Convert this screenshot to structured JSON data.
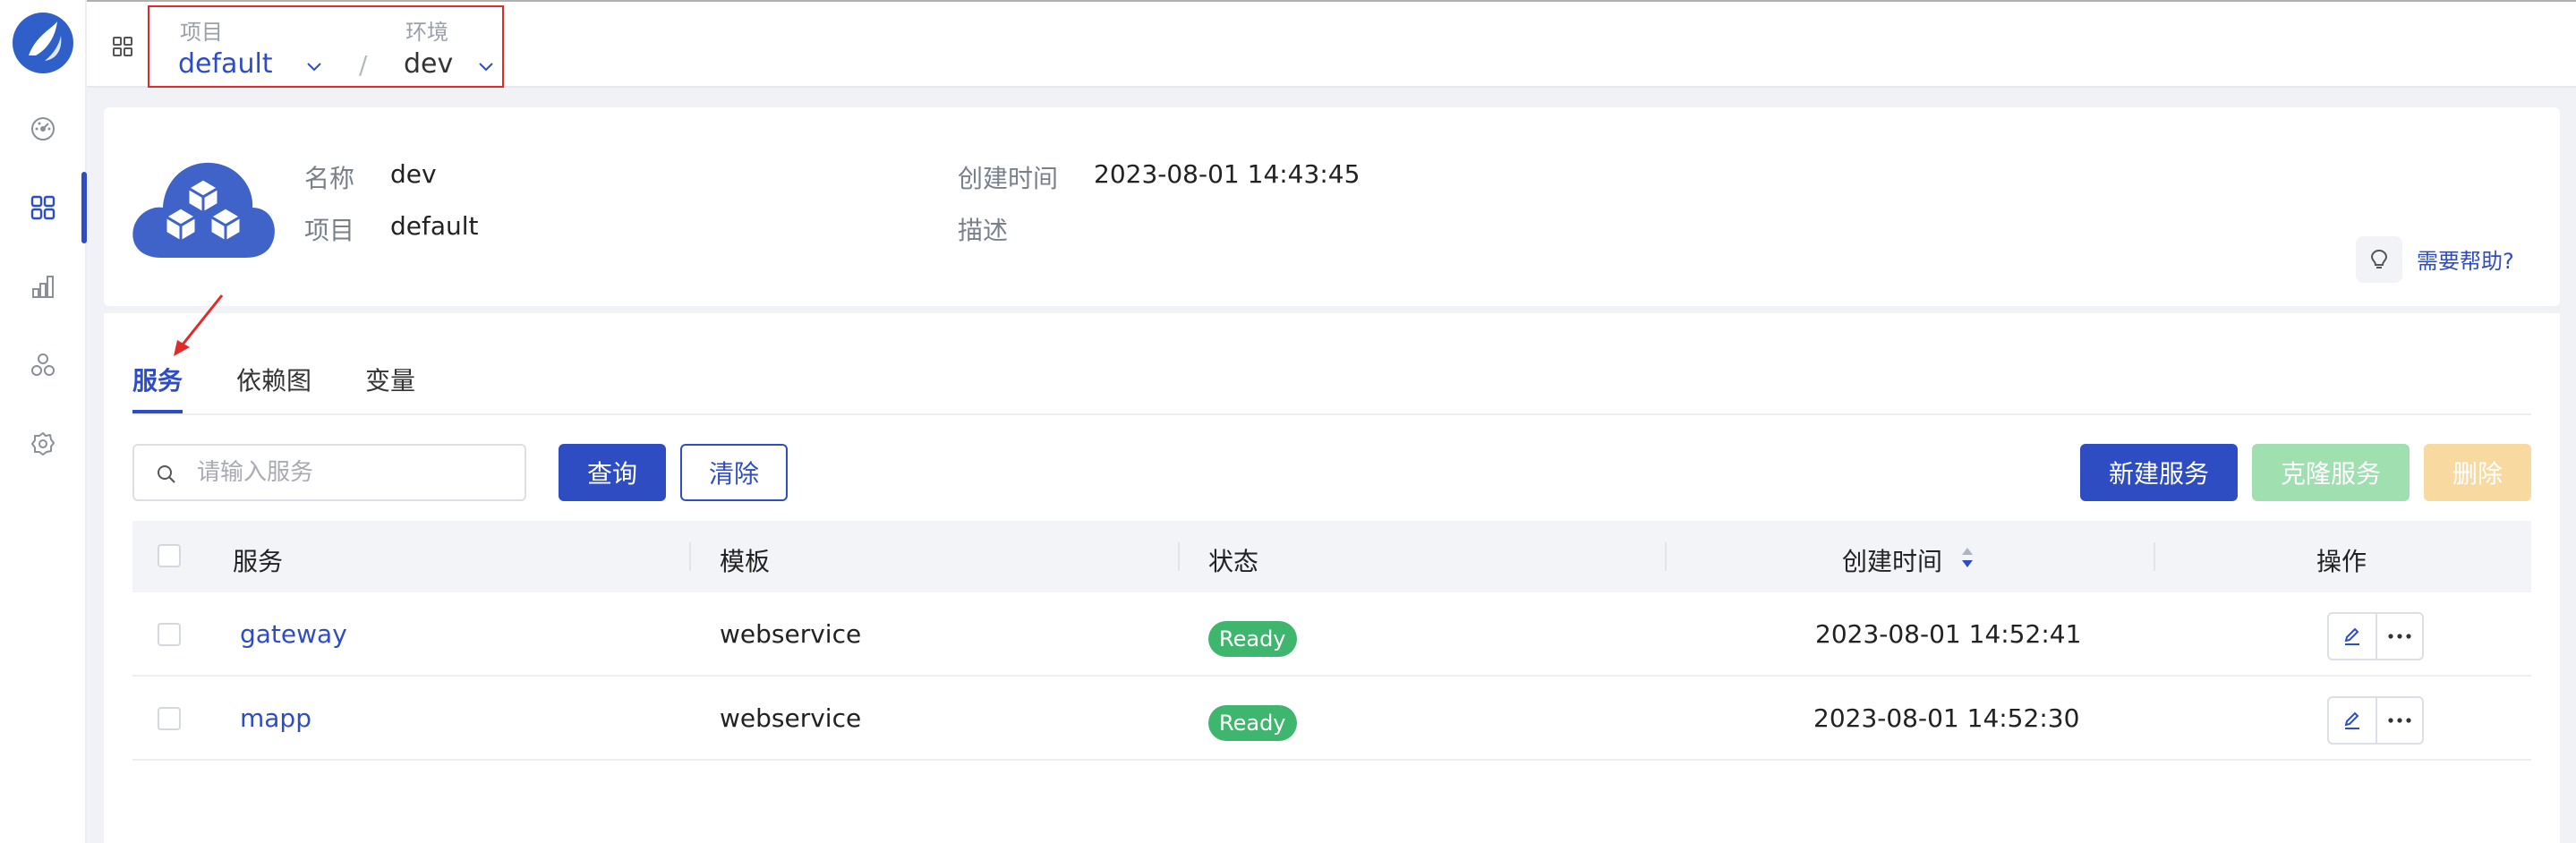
{
  "topbar": {
    "project_label": "项目",
    "project_value": "default",
    "env_label": "环境",
    "env_value": "dev",
    "separator": "/"
  },
  "sidebar": {
    "items": [
      {
        "icon": "dashboard-icon"
      },
      {
        "icon": "apps-grid-icon",
        "active": true
      },
      {
        "icon": "bar-chart-icon"
      },
      {
        "icon": "cluster-icon"
      },
      {
        "icon": "gear-icon"
      }
    ]
  },
  "info": {
    "name_label": "名称",
    "name_value": "dev",
    "project_label": "项目",
    "project_value": "default",
    "created_label": "创建时间",
    "created_value": "2023-08-01 14:43:45",
    "desc_label": "描述",
    "desc_value": "",
    "help_text": "需要帮助?"
  },
  "tabs": [
    {
      "label": "服务",
      "active": true
    },
    {
      "label": "依赖图",
      "active": false
    },
    {
      "label": "变量",
      "active": false
    }
  ],
  "toolbar": {
    "search_placeholder": "请输入服务",
    "search_value": "",
    "query_label": "查询",
    "clear_label": "清除",
    "new_label": "新建服务",
    "clone_label": "克隆服务",
    "delete_label": "删除"
  },
  "table": {
    "columns": [
      "服务",
      "模板",
      "状态",
      "创建时间",
      "操作"
    ],
    "rows": [
      {
        "service": "gateway",
        "template": "webservice",
        "status": "Ready",
        "created": "2023-08-01 14:52:41"
      },
      {
        "service": "mapp",
        "template": "webservice",
        "status": "Ready",
        "created": "2023-08-01 14:52:30"
      }
    ]
  },
  "colors": {
    "accent": "#2f4dc2",
    "ready": "#3fb66e",
    "highlight_box": "#e02b2b"
  }
}
